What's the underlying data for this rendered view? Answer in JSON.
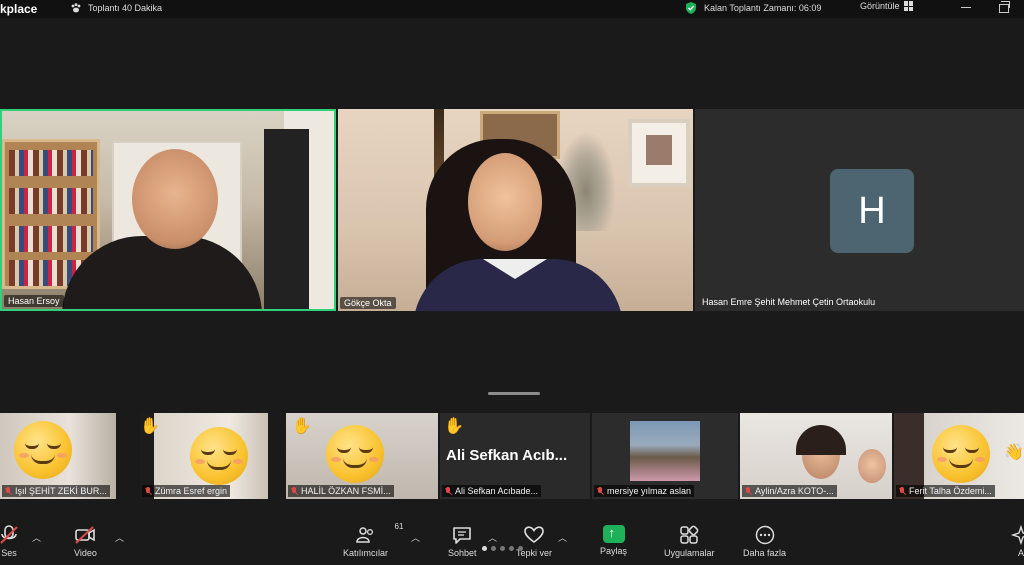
{
  "topbar": {
    "brand": "kplace",
    "meeting_timer": "Toplantı 40 Dakika",
    "remaining_time": "Kalan Toplantı Zamanı: 06:09",
    "view_label": "Görüntüle"
  },
  "main_tiles": [
    {
      "name": "Hasan Ersoy",
      "active_speaker": true
    },
    {
      "name": "Gökçe Okta"
    },
    {
      "name": "Hasan Emre Şehit Mehmet Çetin Ortaokulu",
      "avatar_letter": "H"
    }
  ],
  "gallery": [
    {
      "name": "Işıl ŞEHİT ZEKİ BUR...",
      "muted": true,
      "reaction": "emoji"
    },
    {
      "name": "Zümra Esref ergin",
      "muted": true,
      "reaction": "emoji",
      "raised_hand": true
    },
    {
      "name": "HALİL ÖZKAN FSMİ...",
      "muted": true,
      "reaction": "emoji",
      "raised_hand": true
    },
    {
      "name": "Ali Sefkan Acıbade...",
      "display_title": "Ali Sefkan Acıb...",
      "muted": true,
      "raised_hand": true
    },
    {
      "name": "mersiye yılmaz aslan",
      "muted": true
    },
    {
      "name": "Aylin/Azra KOTO-...",
      "muted": true
    },
    {
      "name": "Ferit Talha Özdemi...",
      "muted": true,
      "reaction": "emoji"
    }
  ],
  "toolbar": {
    "audio_label": "Ses",
    "video_label": "Video",
    "participants_label": "Katılımcılar",
    "participants_count": "61",
    "chat_label": "Sohbet",
    "react_label": "Tepki ver",
    "share_label": "Paylaş",
    "apps_label": "Uygulamalar",
    "more_label": "Daha fazla",
    "right_partial": "A"
  },
  "colors": {
    "active_speaker_border": "#2fd17a",
    "share_green": "#1fb05a",
    "muted_red": "#e04848",
    "avatar_bg": "#4d6570"
  }
}
